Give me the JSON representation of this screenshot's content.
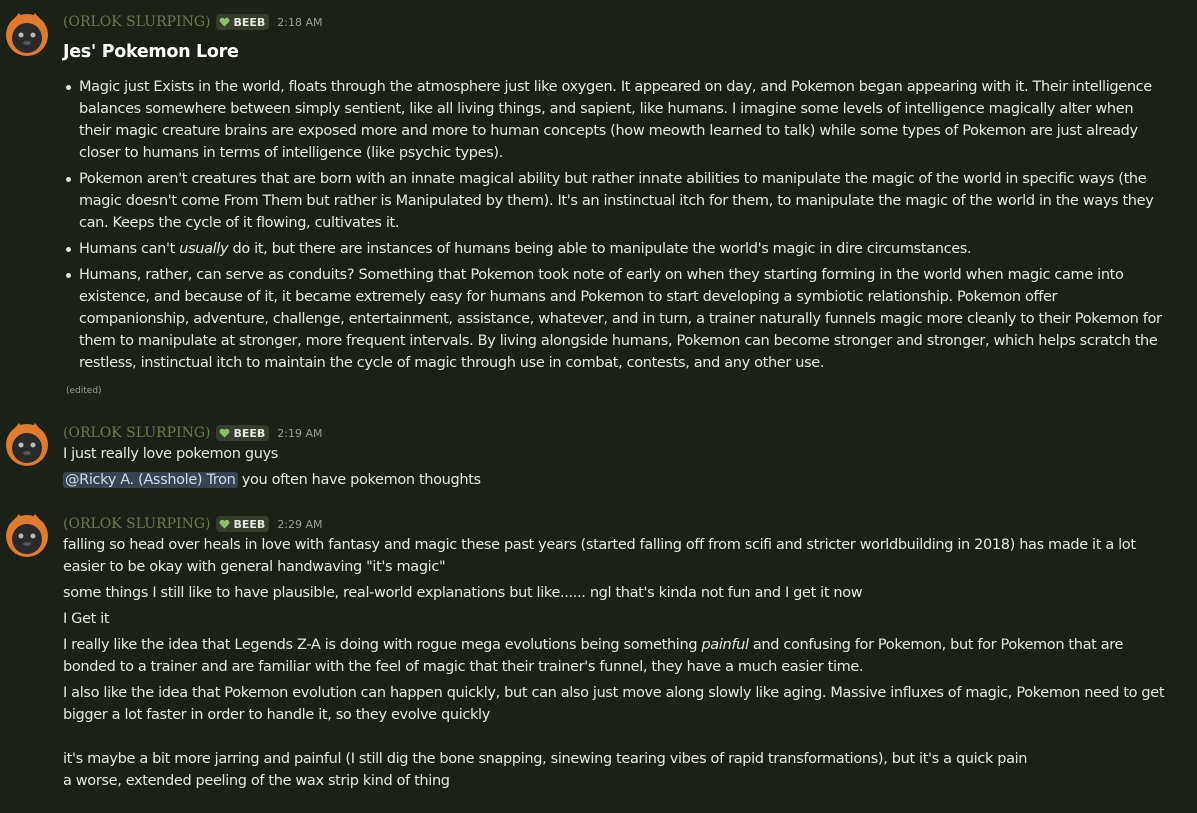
{
  "colors": {
    "background": "#1c2117",
    "username": "#6b7a4a",
    "tag_bg": "#363d2f",
    "heart": "#8fbf6a",
    "mention_bg": "#3a4352",
    "avatar_outer": "#e07a2e",
    "avatar_inner": "#2a2a2a"
  },
  "messages": [
    {
      "author": "(ORLOK SLURPING)",
      "tag": "BEEB",
      "timestamp": "2:18 AM",
      "title": "Jes' Pokemon Lore",
      "bullets": [
        {
          "before": "Magic just Exists in the world, floats through the atmosphere just like oxygen. It appeared on day, and Pokemon began appearing with it. Their intelligence balances somewhere between simply sentient, like all living things, and sapient, like humans. I imagine some levels of intelligence magically alter when their magic creature brains are exposed more and more to human concepts (how meowth learned to talk) while some types of Pokemon are just already closer to humans in terms of intelligence (like psychic types)."
        },
        {
          "before": "Pokemon aren't creatures that are born with an innate magical ability but rather innate abilities to manipulate the magic of the world in specific ways (the magic doesn't come From Them but rather is Manipulated by them). It's an instinctual itch for them, to manipulate the magic of the world in the ways they can. Keeps the cycle of it flowing, cultivates it."
        },
        {
          "before": "Humans can't ",
          "em": "usually",
          "after": " do it, but there are instances of humans being able to manipulate the world's magic in dire circumstances."
        },
        {
          "before": "Humans, rather, can serve as conduits? Something that Pokemon took note of early on when they starting forming in the world when magic came into existence, and because of it, it became extremely easy for humans and Pokemon to start developing a symbiotic relationship. Pokemon offer companionship, adventure, challenge, entertainment, assistance, whatever, and in turn, a trainer naturally funnels magic more cleanly to their Pokemon for them to manipulate at stronger, more frequent intervals. By living alongside humans, Pokemon can become stronger and stronger, which helps scratch the restless, instinctual itch to maintain the cycle of magic through use in combat, contests, and any other use."
        }
      ],
      "edited": "(edited)"
    },
    {
      "author": "(ORLOK SLURPING)",
      "tag": "BEEB",
      "timestamp": "2:19 AM",
      "line1": "I just really love pokemon guys",
      "mention": "@Ricky A. (Asshole) Tron",
      "line2": " you often have pokemon thoughts"
    },
    {
      "author": "(ORLOK SLURPING)",
      "tag": "BEEB",
      "timestamp": "2:29 AM",
      "p1": "falling so head over heals in love with fantasy and magic these past years (started falling off from scifi and stricter worldbuilding in 2018) has made it a lot easier to be okay with general handwaving \"it's magic\"",
      "p2": "some things I still like to have plausible, real-world explanations but like...... ngl that's kinda not fun and I get it now",
      "p3": "I Get it",
      "p4a": "I really like the idea that Legends Z-A is doing with rogue mega evolutions being something ",
      "p4em": "painful",
      "p4b": " and confusing for Pokemon, but for Pokemon that are bonded to a trainer and are familiar with the feel of magic that their trainer's funnel, they have a much easier time.",
      "p5": "I also like the idea that Pokemon evolution can happen quickly, but can also just move along slowly like aging. Massive influxes of magic, Pokemon need to get bigger a lot faster in order to handle it, so they evolve quickly",
      "p6": "it's maybe a bit more jarring and painful (I still dig the bone snapping, sinewing tearing vibes of rapid transformations), but it's a quick pain",
      "p7": "a worse, extended peeling of the wax strip kind of thing"
    }
  ]
}
